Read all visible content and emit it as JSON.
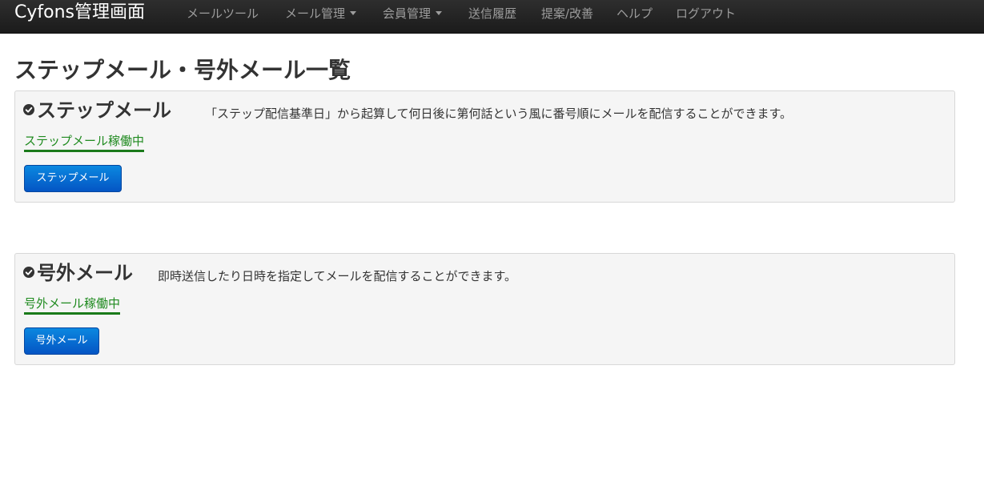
{
  "navbar": {
    "brand": "Cyfons管理画面",
    "items": [
      {
        "label": "メールツール",
        "has_dropdown": false
      },
      {
        "label": "メール管理",
        "has_dropdown": true
      },
      {
        "label": "会員管理",
        "has_dropdown": true
      },
      {
        "label": "送信履歴",
        "has_dropdown": false
      },
      {
        "label": "提案/改善",
        "has_dropdown": false
      },
      {
        "label": "ヘルプ",
        "has_dropdown": false
      },
      {
        "label": "ログアウト",
        "has_dropdown": false
      }
    ]
  },
  "page_title": "ステップメール・号外メール一覧",
  "panels": {
    "step": {
      "heading": "ステップメール",
      "description": "「ステップ配信基準日」から起算して何日後に第何話という風に番号順にメールを配信することができます。",
      "status": "ステップメール稼働中",
      "button_label": "ステップメール"
    },
    "extra": {
      "heading": "号外メール",
      "description": "即時送信したり日時を指定してメールを配信することができます。",
      "status": "号外メール稼働中",
      "button_label": "号外メール"
    }
  },
  "colors": {
    "navbar_bg": "#222222",
    "status_green": "#1f8a1f",
    "button_blue": "#0769d2",
    "panel_bg": "#f5f5f5"
  }
}
